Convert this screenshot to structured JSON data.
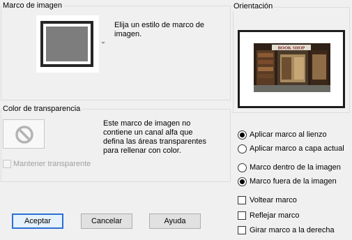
{
  "frame_group": {
    "title": "Marco de imagen",
    "description_line1": "Elija un estilo de marco de",
    "description_line2": "imagen."
  },
  "transparency_group": {
    "title": "Color de transparencia",
    "description_lines": [
      "Este marco de imagen no",
      "contiene un canal alfa que",
      "defina las áreas transparentes",
      "para rellenar con color."
    ],
    "keep_transparent_label": "Mantener transparente",
    "keep_transparent_checked": false,
    "keep_transparent_enabled": false
  },
  "orientation_group": {
    "title": "Orientación",
    "preview_sign_text": "BOOK SHOP"
  },
  "apply_options": [
    {
      "label": "Aplicar marco al lienzo",
      "checked": true
    },
    {
      "label": "Aplicar marco a capa actual",
      "checked": false
    }
  ],
  "position_options": [
    {
      "label": "Marco dentro de la imagen",
      "checked": false
    },
    {
      "label": "Marco fuera de la imagen",
      "checked": true
    }
  ],
  "transform_options": [
    {
      "label": "Voltear marco",
      "checked": false
    },
    {
      "label": "Reflejar marco",
      "checked": false
    },
    {
      "label": "Girar marco a la derecha",
      "checked": false
    }
  ],
  "buttons": {
    "accept": "Aceptar",
    "cancel": "Cancelar",
    "help": "Ayuda"
  },
  "colors": {
    "accent": "#2b6fd6",
    "frame_dark": "#262626",
    "frame_inner": "#7d7d7d",
    "dialog_bg": "#f0f0f0"
  }
}
